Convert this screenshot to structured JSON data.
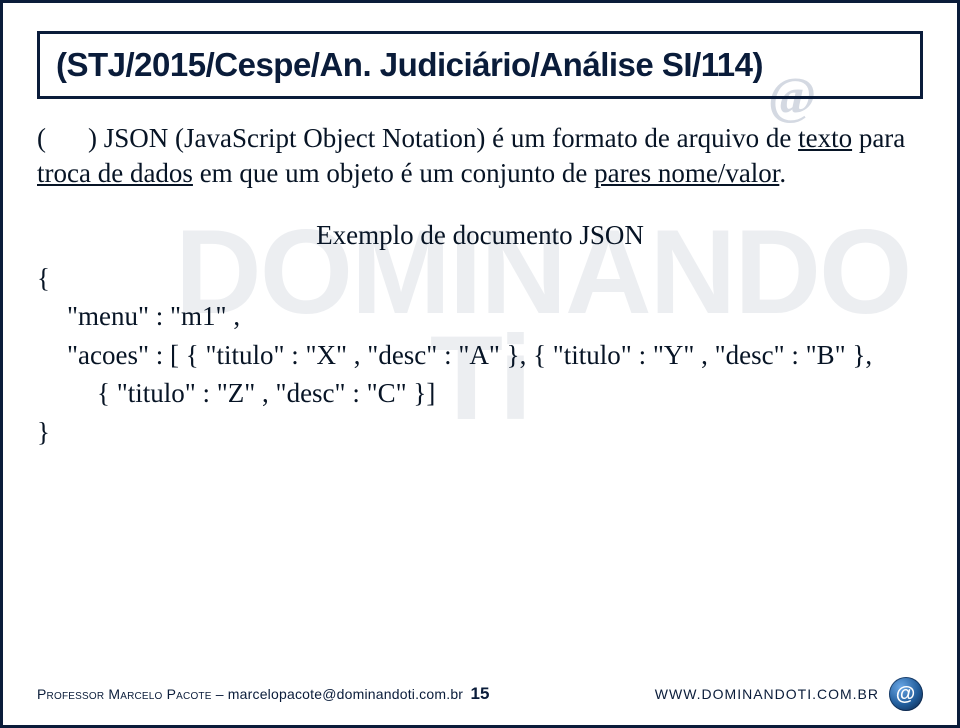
{
  "title": "(STJ/2015/Cespe/An. Judiciário/Análise SI/114)",
  "para": {
    "p1": "(",
    "p2": ") JSON (JavaScript Object Notation) é um formato de arquivo de ",
    "u1": "texto",
    "p3": " para ",
    "u2": "troca de dados",
    "p4": " em que um objeto é um conjunto de ",
    "u3": "pares nome/valor",
    "p5": "."
  },
  "example_title": "Exemplo de documento JSON",
  "json": {
    "open": "{",
    "line1": "\"menu\" : \"m1\" ,",
    "line2a": "\"acoes\" : [ { \"titulo\" : \"X\" , \"desc\" : \"A\" }, { \"titulo\" : \"Y\" , \"desc\" : \"B\" },",
    "line2b": "{ \"titulo\" : \"Z\" , \"desc\" : \"C\" }]",
    "close": "}"
  },
  "footer": {
    "left_name": "Professor Marcelo Pacote",
    "left_sep": " – ",
    "left_email": "marcelopacote@dominandoti.com.br",
    "page": "15",
    "right_prefix": "www.",
    "right_domain": "dominandoti.com.br",
    "brand_glyph": "@"
  },
  "watermark": "DOMINANDO\nTi"
}
